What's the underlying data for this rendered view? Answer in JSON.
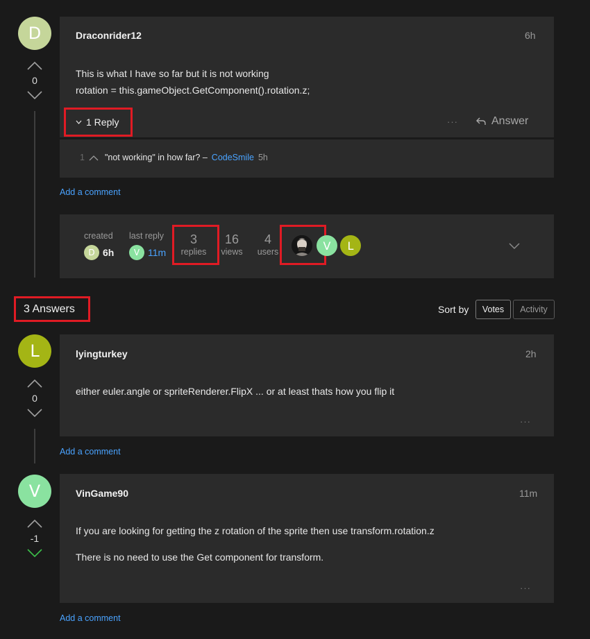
{
  "question": {
    "author_initial": "D",
    "author": "Draconrider12",
    "time": "6h",
    "vote_count": "0",
    "body_line1": "This is what I have so far but it is not working",
    "body_line2": "rotation = this.gameObject.GetComponent().rotation.z;",
    "reply_toggle": "1 Reply",
    "more": "···",
    "answer_label": "Answer",
    "reply": {
      "votes": "1",
      "text": "\"not working\" in how far? –",
      "author": "CodeSmile",
      "time": "5h"
    },
    "add_comment": "Add a comment",
    "stats": {
      "created_label": "created",
      "created_initial": "D",
      "created_time": "6h",
      "last_reply_label": "last reply",
      "last_reply_initial": "V",
      "last_reply_time": "11m",
      "replies_count": "3",
      "replies_label": "replies",
      "views_count": "16",
      "views_label": "views",
      "users_count": "4",
      "users_label": "users",
      "user_initials": [
        "V",
        "L"
      ]
    }
  },
  "answers_header": "3 Answers",
  "sort": {
    "label": "Sort by",
    "options": [
      "Votes",
      "Activity"
    ],
    "selected": "Votes"
  },
  "answers": [
    {
      "initial": "L",
      "author": "lyingturkey",
      "time": "2h",
      "votes": "0",
      "lines": [
        "either euler.angle or spriteRenderer.FlipX ... or at least thats how you flip it"
      ],
      "more": "···",
      "add_comment": "Add a comment"
    },
    {
      "initial": "V",
      "author": "VinGame90",
      "time": "11m",
      "votes": "-1",
      "lines": [
        "If you are looking for getting the z rotation of the sprite then use transform.rotation.z",
        "There is no need to use the Get component for transform."
      ],
      "more": "···",
      "add_comment": "Add a comment"
    }
  ],
  "colors": {
    "avatar_d": "#c5d69a",
    "avatar_l": "#a4b515",
    "avatar_v": "#8ae2a0",
    "highlight": "#e01b24",
    "link": "#4aa3ff",
    "downvote_active": "#3cc04a"
  }
}
